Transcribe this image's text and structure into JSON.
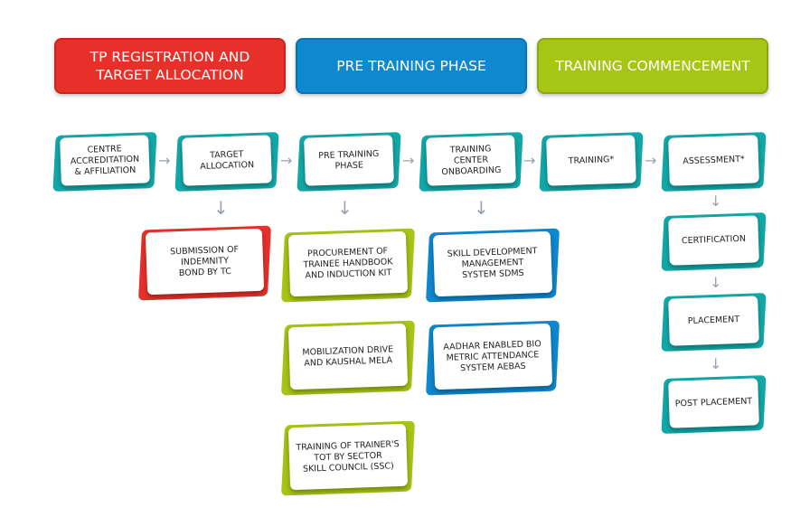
{
  "colors": {
    "red": "#e8302a",
    "blue": "#0e88cf",
    "green": "#a6c514",
    "teal": "#13a8a8"
  },
  "headers": [
    {
      "label": "TP REGISTRATION AND\nTARGET ALLOCATION"
    },
    {
      "label": "PRE TRAINING PHASE"
    },
    {
      "label": "TRAINING COMMENCEMENT"
    }
  ],
  "steps": [
    "CENTRE\nACCREDITATION\n& AFFILIATION",
    "TARGET\nALLOCATION",
    "PRE TRAINING\nPHASE",
    "TRAINING CENTER\nONBOARDING",
    "TRAINING*",
    "ASSESSMENT*"
  ],
  "sub": {
    "submission": "SUBMISSION OF\nINDEMNITY\nBOND BY TC",
    "procurement": "PROCUREMENT OF\nTRAINEE HANDBOOK\nAND INDUCTION KIT",
    "mobilization": "MOBILIZATION DRIVE\nAND KAUSHAL MELA",
    "tot": "TRAINING OF TRAINER'S\nTOT BY SECTOR\nSKILL COUNCIL (SSC)",
    "sdms": "SKILL DEVELOPMENT\nMANAGEMENT\nSYSTEM SDMS",
    "aebas": "AADHAR ENABLED BIO\nMETRIC ATTENDANCE\nSYSTEM  AEBAS",
    "certification": "CERTIFICATION",
    "placement": "PLACEMENT",
    "post_placement": "POST PLACEMENT"
  }
}
